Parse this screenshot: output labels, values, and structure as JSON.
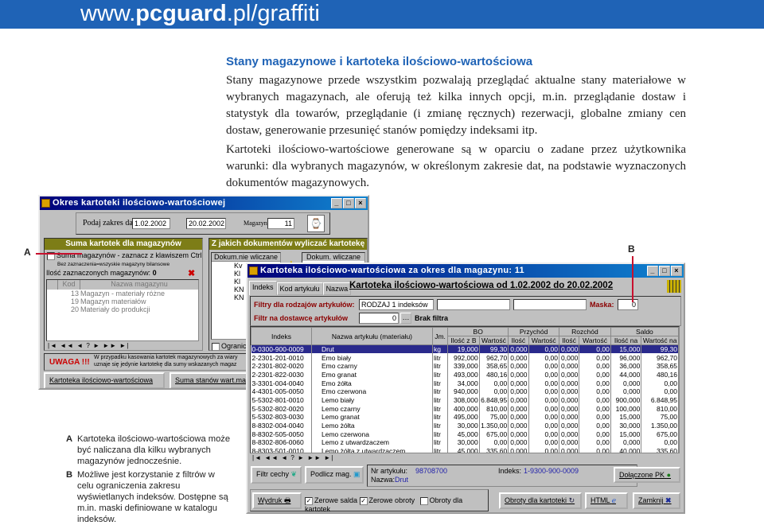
{
  "header": {
    "site_prefix": "www.",
    "site_bold": "pcguard",
    "site_suffix": ".pl/graffiti"
  },
  "article": {
    "title": "Stany magazynowe i kartoteka ilościowo-wartościowa",
    "p1": "Stany magazynowe przede wszystkim pozwalają przeglądać aktualne stany materiałowe w wybranych magazynach, ale oferują też kilka innych opcji, m.in. przeglądanie dostaw i statystyk dla towarów, przeglądanie (i zmianę ręcznych) rezerwacji, globalne zmiany cen dostaw, generowanie przesunięć stanów pomiędzy indeksami itp.",
    "p2": "Kartoteki ilościowo-wartościowe generowane są w oparciu o zadane przez użytkownika warunki: dla wybranych magazynów, w określonym zakresie dat, na podstawie wyznaczonych dokumentów magazynowych."
  },
  "captions": [
    {
      "letter": "A",
      "text": "Kartoteka ilościowo-wartościowa może być naliczana dla kilku wybranych magazynów jednocześnie."
    },
    {
      "letter": "B",
      "text": "Możliwe jest korzystanie z filtrów w celu ograniczenia zakresu wyświetlanych indeksów. Dostępne są m.in. maski definiowane w katalogu indeksów."
    }
  ],
  "markers": {
    "a": "A",
    "b": "B",
    "accent": "#c8102e"
  },
  "window1": {
    "title": "Okres kartoteki ilościowo-wartościowej",
    "date_label": "Podaj zakres dat:",
    "date_from": "1.02.2002",
    "date_to": "20.02.2002",
    "magazyn_label": "Magazyn:",
    "magazyn_value": "11",
    "left_header": "Suma kartotek dla magazynów",
    "sum_check": "Suma magazynów - zaznacz z klawiszem Ctrl",
    "sum_hint": "Bez zaznaczenia=wszyskie magazyny bilansowe",
    "count_label": "Ilość zaznaczonych magazynów:",
    "count_value": "0",
    "cols": [
      "Kod",
      "Nazwa magazynu"
    ],
    "rows": [
      {
        "kod": "13",
        "nazwa": "Magazyn - materiały różne"
      },
      {
        "kod": "19",
        "nazwa": "Magazyn materiałów"
      },
      {
        "kod": "20",
        "nazwa": "Materiały do produkcji"
      }
    ],
    "right_header": "Z jakich dokumentów wyliczać kartotekę",
    "list_excluded": "Dokum.nie wliczane",
    "list_included": "Dokum. wliczane",
    "excluded_items": [
      "Kv",
      "Kl",
      "Kl",
      "KN",
      "KN"
    ],
    "limit_check": "Ogranic",
    "warning_title": "UWAGA !!!",
    "warning_text1": "W przypadku kasowania kartotek magazynowych za wiary",
    "warning_text2": "uznaje się jedynie kartotekę dla sumy wskazanych magaz",
    "btn_kartoteka": "Kartoteka ilościowo-wartościowa",
    "btn_suma": "Suma stanów wart.mag"
  },
  "window2": {
    "title": "Kartoteka ilościowo-wartościowa za okres dla magazynu: 11",
    "tabs": [
      "Indeks",
      "Kod artykułu",
      "Nazwa"
    ],
    "heading": "Kartoteka ilościowo-wartościowa od  1.02.2002 do 20.02.2002",
    "filter_label": "Filtry dla rodzajów artykułów:",
    "filter1": "RODZAJ 1 indeksów",
    "filter2": "",
    "filter3": "",
    "mask_label": "Maska:",
    "mask_value": "0",
    "supplier_label": "Filtr na dostawcę artykułów",
    "supplier_value": "0",
    "supplier_status": "Brak filtra",
    "group_headers": [
      "BO",
      "Przychód",
      "Rozchód",
      "Saldo"
    ],
    "columns": [
      "Indeks",
      "Nazwa artykułu (materiału)",
      "Jm.",
      "Ilość z B",
      "Wartość",
      "Ilość",
      "Wartość",
      "Ilość",
      "Wartość",
      "Ilość na",
      "Wartość na"
    ],
    "rows": [
      [
        "0-0300-900-0009",
        "Drut",
        "kg",
        "19,000",
        "99,30",
        "0,000",
        "0,00",
        "0,000",
        "0,00",
        "15,000",
        "99,30"
      ],
      [
        "2-2301-201-0010",
        "Emo biały",
        "litr",
        "992,000",
        "962,70",
        "0,000",
        "0,00",
        "0,000",
        "0,00",
        "96,000",
        "962,70"
      ],
      [
        "2-2301-802-0020",
        "Emo czarny",
        "litr",
        "339,000",
        "358,65",
        "0,000",
        "0,00",
        "0,000",
        "0,00",
        "36,000",
        "358,65"
      ],
      [
        "2-2301-822-0030",
        "Emo granat",
        "litr",
        "493,000",
        "480,16",
        "0,000",
        "0,00",
        "0,000",
        "0,00",
        "44,000",
        "480,16"
      ],
      [
        "3-3301-004-0040",
        "Emo żółta",
        "litr",
        "34,000",
        "0,00",
        "0,000",
        "0,00",
        "0,000",
        "0,00",
        "0,000",
        "0,00"
      ],
      [
        "4-4301-005-0050",
        "Emo czerwona",
        "litr",
        "940,000",
        "0,00",
        "0,000",
        "0,00",
        "0,000",
        "0,00",
        "0,000",
        "0,00"
      ],
      [
        "5-5302-801-0010",
        "Lemo biały",
        "litr",
        "308,000",
        "6.848,95",
        "0,000",
        "0,00",
        "0,000",
        "0,00",
        "900,000",
        "6.848,95"
      ],
      [
        "5-5302-802-0020",
        "Lemo czarny",
        "litr",
        "400,000",
        "810,00",
        "0,000",
        "0,00",
        "0,000",
        "0,00",
        "100,000",
        "810,00"
      ],
      [
        "5-5302-803-0030",
        "Lemo granat",
        "litr",
        "495,000",
        "75,00",
        "0,000",
        "0,00",
        "0,000",
        "0,00",
        "15,000",
        "75,00"
      ],
      [
        "8-8302-004-0040",
        "Lemo żółta",
        "litr",
        "30,000",
        "1.350,00",
        "0,000",
        "0,00",
        "0,000",
        "0,00",
        "30,000",
        "1.350,00"
      ],
      [
        "8-8302-505-0050",
        "Lemo czerwona",
        "litr",
        "45,000",
        "675,00",
        "0,000",
        "0,00",
        "0,000",
        "0,00",
        "15,000",
        "675,00"
      ],
      [
        "8-8302-806-0060",
        "Lemo z utwardzaczem",
        "litr",
        "30,000",
        "0,00",
        "0,000",
        "0,00",
        "0,000",
        "0,00",
        "0,000",
        "0,00"
      ],
      [
        "8-8303-501-0010",
        "Lemo żółta z utwardzaczem",
        "litr",
        "45,000",
        "335,60",
        "0,000",
        "0,00",
        "0,000",
        "0,00",
        "40,000",
        "335,60"
      ]
    ],
    "nav": "|◄ ◄◄ ◄ ? ► ►► ►|",
    "btn_filtr": "Filtr cechy",
    "btn_podlicz": "Podlicz mag.",
    "nr_label": "Nr artykułu:",
    "nr_value": "98708700",
    "nazwa_label": "Nazwa:",
    "nazwa_value": "Drut",
    "indeks_label": "Indeks:",
    "indeks_value": "1-9300-900-0009",
    "btn_dolaczone": "Dołączone PK",
    "btn_wydruk": "Wydruk",
    "chk_saldo": "Zerowe salda",
    "chk_obroty": "Zerowe obroty",
    "chk_kartotek": "Obroty dla kartotek",
    "chk_saldo_on": true,
    "chk_obroty_on": true,
    "chk_kartotek_on": false,
    "btn_obroty": "Obroty dla kartoteki",
    "btn_html": "HTML",
    "btn_zamknij": "Zamknij"
  }
}
